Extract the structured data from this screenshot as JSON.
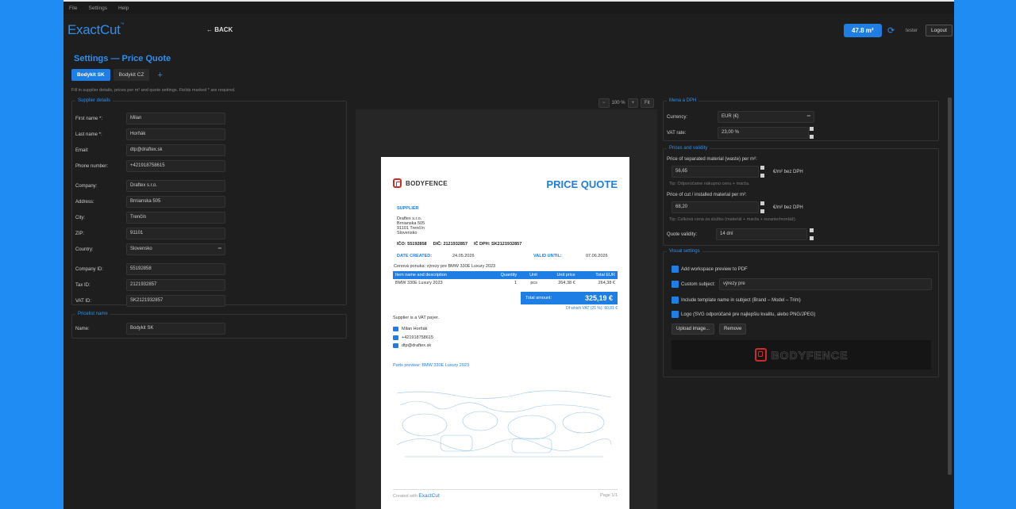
{
  "menu": [
    "File",
    "Settings",
    "Help"
  ],
  "app": {
    "logo": "ExactCut",
    "logo_mark": "™",
    "back": "← BACK",
    "area": "47.8 m²",
    "user": "tester",
    "logout": "Logout",
    "refresh_icon": "refresh-icon"
  },
  "page": {
    "title": "Settings — Price Quote",
    "hint": "Fill in supplier details, prices per m² and quote settings. Fields marked * are required."
  },
  "tabs": [
    {
      "label": "Bodykit SK",
      "active": true
    },
    {
      "label": "Bodykit CZ",
      "active": false
    }
  ],
  "tab_add": "+",
  "supplier": {
    "legend": "Supplier details",
    "fields": [
      {
        "label": "First name *:",
        "value": "Milan"
      },
      {
        "label": "Last name *:",
        "value": "Horňák"
      },
      {
        "label": "Email:",
        "value": "dtp@draftex.sk"
      },
      {
        "label": "Phone number:",
        "value": "+421918758615"
      },
      {
        "label": "Company:",
        "value": "Draftex s.r.o."
      },
      {
        "label": "Address:",
        "value": "Brnianska 505"
      },
      {
        "label": "City:",
        "value": "Trenčín"
      },
      {
        "label": "ZIP:",
        "value": "91101"
      },
      {
        "label": "Country:",
        "value": "Slovensko"
      },
      {
        "label": "Company ID:",
        "value": "55192858"
      },
      {
        "label": "Tax ID:",
        "value": "2121932857"
      },
      {
        "label": "VAT ID:",
        "value": "SK2121932857"
      }
    ]
  },
  "pricelist": {
    "legend": "Pricelist name",
    "label": "Name:",
    "value": "Bodykit SK"
  },
  "zoom": {
    "minus": "−",
    "level": "100 %",
    "plus": "+",
    "fit": "Fit"
  },
  "doc": {
    "brand": "BODYFENCE",
    "title": "PRICE QUOTE",
    "supplier_h": "SUPPLIER",
    "addr": [
      "Draftex s.r.o.",
      "Brnianska 505",
      "91101 Trenčín",
      "Slovensko"
    ],
    "ico": "IČO: 55192858",
    "dic": "DIČ: 2121932857",
    "icdph": "IČ DPH: SK2121932857",
    "date_created_l": "DATE CREATED:",
    "date_created": "24.05.2026",
    "valid_l": "VALID UNTIL:",
    "valid": "07.06.2026",
    "subject": "Cenová ponuka: výrezy pre BMW 330E Luxury 2023",
    "table_head": [
      "Item name and description",
      "Quantity",
      "Unit",
      "Unit price",
      "Total EUR"
    ],
    "table_row": [
      "BMW 330E Luxury 2023",
      "1",
      "pcs",
      "264,38 €",
      "264,38 €"
    ],
    "total_l": "Total amount:",
    "total": "325,19 €",
    "vat_note": "Of which VAT (21 %): 60,81 €",
    "vat_payer": "Supplier is a VAT payer.",
    "contact_name": "Milan Horňák",
    "contact_phone": "+421918758615",
    "contact_email": "dtp@draftex.sk",
    "parts": "Parts preview: BMW 330E Luxury 2023",
    "created": "Created with",
    "created_brand": "ExactCut",
    "page": "Page 1/1"
  },
  "currency": {
    "legend": "Mena a DPH",
    "currency_l": "Currency:",
    "currency": "EUR (€)",
    "vat_l": "VAT rate:",
    "vat": "23,00 %"
  },
  "prices": {
    "legend": "Prices and validity",
    "waste_l": "Price of separated material (waste) per m²:",
    "waste": "56,65",
    "unit": "€/m² bez DPH",
    "waste_tip": "Tip: Odporúčame nákupnú cenu + marža.",
    "cut_l": "Price of cut / installed material per m²:",
    "cut": "68,20",
    "cut_tip": "Tip: Celková cena za službu (materiál + marža + rezanie/montáž).",
    "valid_l": "Quote validity:",
    "valid": "14 dní"
  },
  "visual": {
    "legend": "Visual settings",
    "ws": "Add workspace preview to PDF",
    "subj_l": "Custom subject:",
    "subj": "výrezy pre",
    "tpl": "Include template name in subject (Brand – Model – Trim)",
    "logo": "Logo (SVG odporúčané pre najlepšiu kvalitu, alebo PNG/JPEG)",
    "upload": "Upload image...",
    "remove": "Remove",
    "logo_preview": "BODYFENCE"
  },
  "colors": {
    "accent": "#1f7ee3",
    "bg": "#1e1e1e",
    "frame": "#1f8cf3"
  }
}
